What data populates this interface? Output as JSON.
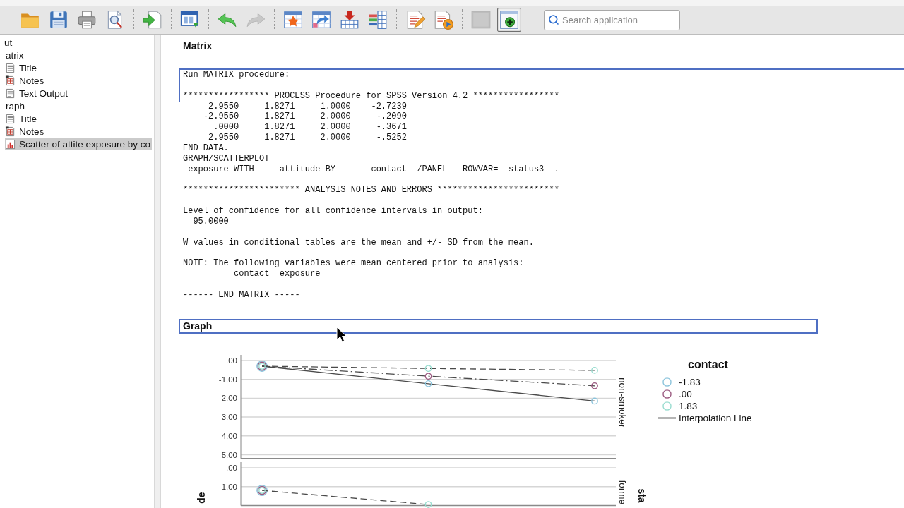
{
  "toolbar": {
    "groups": [
      [
        {
          "kind": "open",
          "disabled": false,
          "pressed": false
        },
        {
          "kind": "save",
          "disabled": false,
          "pressed": false
        },
        {
          "kind": "print",
          "disabled": false,
          "pressed": false
        },
        {
          "kind": "preview",
          "disabled": false,
          "pressed": false
        }
      ],
      [
        {
          "kind": "export",
          "disabled": false,
          "pressed": false
        }
      ],
      [
        {
          "kind": "recall",
          "disabled": false,
          "pressed": false
        }
      ],
      [
        {
          "kind": "undo",
          "disabled": false,
          "pressed": false
        },
        {
          "kind": "redo",
          "disabled": true,
          "pressed": false
        }
      ],
      [
        {
          "kind": "goto_case",
          "disabled": false,
          "pressed": false
        },
        {
          "kind": "goto_variable",
          "disabled": false,
          "pressed": false
        },
        {
          "kind": "insert",
          "disabled": false,
          "pressed": false
        },
        {
          "kind": "variables",
          "disabled": false,
          "pressed": false
        }
      ],
      [
        {
          "kind": "edit",
          "disabled": false,
          "pressed": false
        },
        {
          "kind": "run",
          "disabled": false,
          "pressed": false
        }
      ],
      [
        {
          "kind": "blank",
          "disabled": true,
          "pressed": false
        },
        {
          "kind": "add_pane",
          "disabled": false,
          "pressed": true
        }
      ]
    ],
    "search": {
      "placeholder": "Search application"
    }
  },
  "outline": {
    "items": [
      {
        "label": "ut",
        "selected": false,
        "children": [
          {
            "label": "atrix",
            "selected": false,
            "children": [
              {
                "label": "Title",
                "kind": "title",
                "selected": false
              },
              {
                "label": "Notes",
                "kind": "notes",
                "selected": false
              },
              {
                "label": "Text Output",
                "kind": "text",
                "selected": false
              }
            ]
          },
          {
            "label": "raph",
            "selected": false,
            "children": [
              {
                "label": "Title",
                "kind": "title",
                "selected": false
              },
              {
                "label": "Notes",
                "kind": "notes",
                "selected": false
              },
              {
                "label": "Scatter of attite exposure by co",
                "kind": "chart",
                "selected": true
              }
            ]
          }
        ]
      }
    ]
  },
  "output": {
    "matrix_title": {
      "text": "Matrix",
      "selected": false
    },
    "text_output": {
      "selected": true,
      "header_blocks": [
        [
          "Run MATRIX procedure:"
        ],
        [
          "***************** PROCESS Procedure for SPSS Version 4.2 *****************"
        ]
      ],
      "blocks": [
        [
          "     2.9550     1.8271     1.0000    -2.7239",
          "    -2.9550     1.8271     2.0000     -.2090",
          "      .0000     1.8271     2.0000     -.3671",
          "     2.9550     1.8271     2.0000     -.5252",
          "END DATA.",
          "GRAPH/SCATTERPLOT=",
          " exposure WITH     attitude BY       contact  /PANEL   ROWVAR=  status3  ."
        ],
        [
          "*********************** ANALYSIS NOTES AND ERRORS ************************"
        ],
        [
          "Level of confidence for all confidence intervals in output:",
          "  95.0000"
        ],
        [
          "W values in conditional tables are the mean and +/- SD from the mean."
        ],
        [
          "NOTE: The following variables were mean centered prior to analysis:",
          "          contact  exposure"
        ],
        [
          "------ END MATRIX -----"
        ]
      ]
    },
    "graph": {
      "title": {
        "text": "Graph",
        "selected": true
      },
      "row_variable_label": "sta",
      "panels": [
        {
          "label": "non-smoker",
          "chart_data": {
            "type": "line",
            "grid": true,
            "yticks": [
              {
                "value": 0,
                "label": ".00"
              },
              {
                "value": -1,
                "label": "-1.00"
              },
              {
                "value": -2,
                "label": "-2.00"
              },
              {
                "value": -3,
                "label": "-3.00"
              },
              {
                "value": -4,
                "label": "-4.00"
              },
              {
                "value": -5,
                "label": "-5.00"
              }
            ],
            "ylim": [
              -5.2,
              0.3
            ],
            "series": [
              {
                "line_style": "solid",
                "marker": "circle",
                "values": [
                  -0.3,
                  -1.23,
                  -2.15
                ]
              },
              {
                "line_style": "dashdot",
                "marker": "circle",
                "values": [
                  -0.3,
                  -0.83,
                  -1.34
                ]
              },
              {
                "line_style": "dashed",
                "marker": "circle",
                "values": [
                  -0.3,
                  -0.42,
                  -0.52
                ]
              }
            ]
          }
        },
        {
          "label": "forme",
          "chart_data": {
            "type": "line",
            "grid": true,
            "ylabel": "de",
            "yticks": [
              {
                "value": 0,
                "label": ".00"
              },
              {
                "value": -1,
                "label": "-1.00"
              }
            ],
            "ylim": [
              -2.0,
              0.3
            ],
            "series": [
              {
                "marker": "circle",
                "values": [
                  -1.2,
                  null,
                  null
                ]
              },
              {
                "marker": "circle",
                "values": [
                  -1.2,
                  null,
                  null
                ]
              },
              {
                "line_style": "dashed",
                "marker": "circle",
                "values": [
                  -1.2,
                  -1.95,
                  null
                ]
              }
            ]
          }
        }
      ],
      "legend": {
        "title": "contact",
        "items": [
          {
            "label": "-1.83",
            "color": "#8cc4dc"
          },
          {
            "label": ".00",
            "color": "#9b5a80"
          },
          {
            "label": "1.83",
            "color": "#98dccf"
          }
        ],
        "line_label": "Interpolation Line"
      }
    }
  }
}
